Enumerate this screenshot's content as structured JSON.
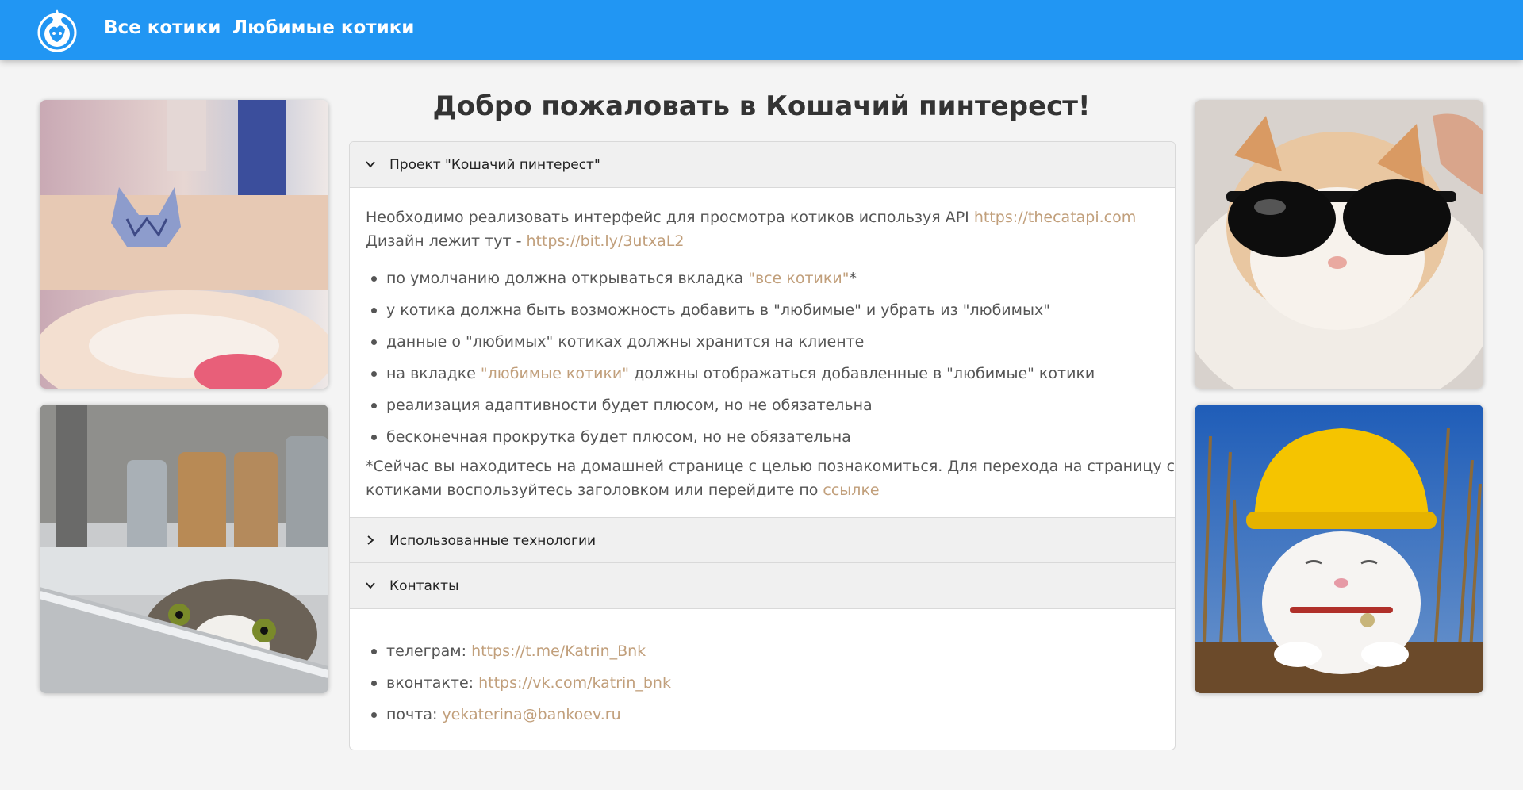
{
  "header": {
    "logo_icon": "cat-dog-logo-icon",
    "nav": [
      {
        "label": "Все котики"
      },
      {
        "label": "Любимые котики"
      }
    ],
    "background": "#2196f3"
  },
  "page": {
    "title": "Добро пожаловать в Кошачий пинтерест!"
  },
  "photos": [
    {
      "subject": "cat peeking over table"
    },
    {
      "subject": "cat hiding in sink"
    },
    {
      "subject": "white cat with sunglasses"
    },
    {
      "subject": "white cat with yellow hard hat"
    }
  ],
  "accordion": {
    "project": {
      "header": "Проект \"Кошачий пинтерест\"",
      "intro_text": "Необходимо реализовать интерфейс для просмотра котиков используя API ",
      "api_link": "https://thecatapi.com",
      "design_text": "Дизайн лежит тут - ",
      "design_link": "https://bit.ly/3utxaL2",
      "items": [
        {
          "before": "по умолчанию должна открываться вкладка ",
          "link": "\"все котики\"",
          "after": "*"
        },
        {
          "before": "у котика должна быть возможность добавить в \"любимые\" и убрать из \"любимых\"",
          "link": "",
          "after": ""
        },
        {
          "before": "данные о \"любимых\" котиках должны хранится на клиенте",
          "link": "",
          "after": ""
        },
        {
          "before": "на вкладке ",
          "link": "\"любимые котики\"",
          "after": " должны отображаться добавленные в \"любимые\" котики"
        },
        {
          "before": "реализация адаптивности будет плюсом, но не обязательна",
          "link": "",
          "after": ""
        },
        {
          "before": "бесконечная прокрутка будет плюсом, но не обязательна",
          "link": "",
          "after": ""
        }
      ],
      "note_line1": "*Сейчас вы находитесь на домашней странице с целью познакомиться. Для перехода на страницу с",
      "note_line2": "котиками воспользуйтесь заголовком или перейдите по ",
      "note_link": "ссылке"
    },
    "tech": {
      "header": "Использованные технологии"
    },
    "contacts": {
      "header": "Контакты",
      "items": [
        {
          "label": "телеграм: ",
          "link": "https://t.me/Katrin_Bnk"
        },
        {
          "label": "вконтакте: ",
          "link": "https://vk.com/katrin_bnk"
        },
        {
          "label": "почта: ",
          "link": "yekaterina@bankoev.ru"
        }
      ]
    },
    "link_color": "#c19f7b"
  }
}
